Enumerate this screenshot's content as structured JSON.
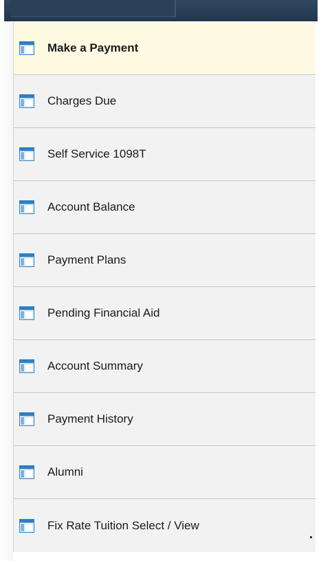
{
  "menu": {
    "items": [
      {
        "label": "Make a Payment",
        "icon": "page-icon",
        "active": true
      },
      {
        "label": "Charges Due",
        "icon": "page-icon",
        "active": false
      },
      {
        "label": "Self Service 1098T",
        "icon": "page-icon",
        "active": false
      },
      {
        "label": "Account Balance",
        "icon": "page-icon",
        "active": false
      },
      {
        "label": "Payment Plans",
        "icon": "page-icon",
        "active": false
      },
      {
        "label": "Pending Financial Aid",
        "icon": "page-icon",
        "active": false
      },
      {
        "label": "Account Summary",
        "icon": "page-icon",
        "active": false
      },
      {
        "label": "Payment History",
        "icon": "page-icon",
        "active": false
      },
      {
        "label": "Alumni",
        "icon": "page-icon",
        "active": false
      },
      {
        "label": "Fix Rate Tuition Select / View",
        "icon": "page-icon",
        "active": false
      }
    ]
  },
  "colors": {
    "header": "#22374c",
    "active_row": "#fffbe3",
    "row": "#f2f2f2",
    "divider": "#c6c6c6",
    "icon_blue": "#2f7fc4"
  }
}
